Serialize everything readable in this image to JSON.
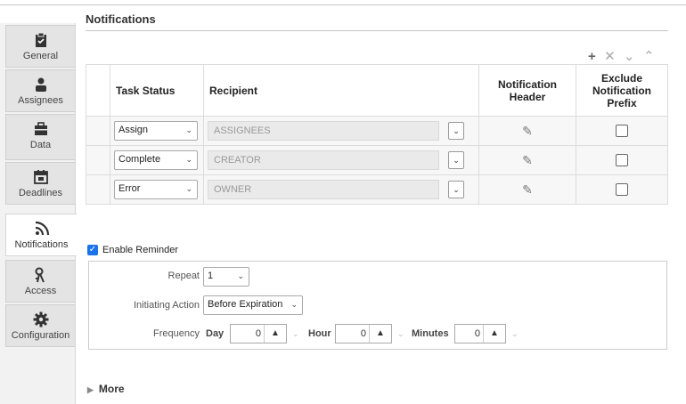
{
  "sidebar": {
    "tabs": [
      {
        "label": "General",
        "icon": "clipboard-check-icon"
      },
      {
        "label": "Assignees",
        "icon": "person-icon"
      },
      {
        "label": "Data",
        "icon": "briefcase-icon"
      },
      {
        "label": "Deadlines",
        "icon": "calendar-icon"
      },
      {
        "label": "Notifications",
        "icon": "rss-icon"
      },
      {
        "label": "Access",
        "icon": "keys-icon"
      },
      {
        "label": "Configuration",
        "icon": "gear-icon"
      }
    ],
    "active": "Notifications"
  },
  "section_title": "Notifications",
  "toolbar": {
    "add": "+",
    "remove": "✕",
    "move_down": "⌄",
    "move_up": "⌃"
  },
  "table": {
    "headers": {
      "task_status": "Task Status",
      "recipient": "Recipient",
      "notification_header_1": "Notification",
      "notification_header_2": "Header",
      "exclude_1": "Exclude",
      "exclude_2": "Notification",
      "exclude_3": "Prefix"
    },
    "rows": [
      {
        "status": "Assign",
        "recipient": "ASSIGNEES"
      },
      {
        "status": "Complete",
        "recipient": "CREATOR"
      },
      {
        "status": "Error",
        "recipient": "OWNER"
      }
    ]
  },
  "reminder": {
    "enable_label": "Enable Reminder",
    "enabled": true,
    "repeat_label": "Repeat",
    "repeat_value": "1",
    "initiating_label": "Initiating Action",
    "initiating_value": "Before Expiration",
    "frequency_label": "Frequency",
    "day_label": "Day",
    "day_value": "0",
    "hour_label": "Hour",
    "hour_value": "0",
    "minutes_label": "Minutes",
    "minutes_value": "0"
  },
  "more_label": "More",
  "colors": {
    "accent": "#1a73e8"
  }
}
